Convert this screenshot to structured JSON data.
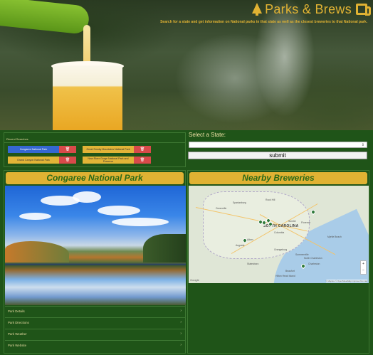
{
  "brand": {
    "title": "Parks & Brews",
    "tagline": "Search for a state and get information on National parks in that state as well as the closest breweries to that National park."
  },
  "recent": {
    "header": "Recent Searches",
    "items": [
      {
        "label": "Congaree National Park",
        "delete": "🗑",
        "active": true
      },
      {
        "label": "Great Smoky Mountains National Park",
        "delete": "🗑",
        "active": false
      },
      {
        "label": "Grand Canyon National Park",
        "delete": "🗑",
        "active": false
      },
      {
        "label": "New River Gorge National Park and Preserve",
        "delete": "🗑",
        "active": false
      }
    ]
  },
  "state_select": {
    "label": "Select a State:",
    "value": "",
    "submit": "submit"
  },
  "park": {
    "title": "Congaree National Park",
    "sections": [
      "Park Details",
      "Park Directions",
      "Park Weather",
      "Park Website"
    ]
  },
  "breweries": {
    "title": "Nearby Breweries",
    "map": {
      "state_label": "SOUTH CAROLINA",
      "cities": [
        "Greenville",
        "Spartanburg",
        "Rock Hill",
        "Columbia",
        "Florence",
        "Myrtle Beach",
        "Charleston",
        "Augusta",
        "Aiken",
        "Orangeburg",
        "Summerville",
        "Sumter",
        "North Charleston",
        "Hilton Head Island",
        "Beaufort",
        "Statesboro"
      ],
      "zoom_in": "+",
      "zoom_out": "−",
      "google": "Google",
      "attribution": "© Mapbox © OpenStreetMap Improve this map"
    }
  },
  "colors": {
    "background": "#1f5418",
    "accent": "#e0b233",
    "title_text": "#2a6a17",
    "blue_chip": "#3567d2",
    "delete": "#d84a4a"
  }
}
